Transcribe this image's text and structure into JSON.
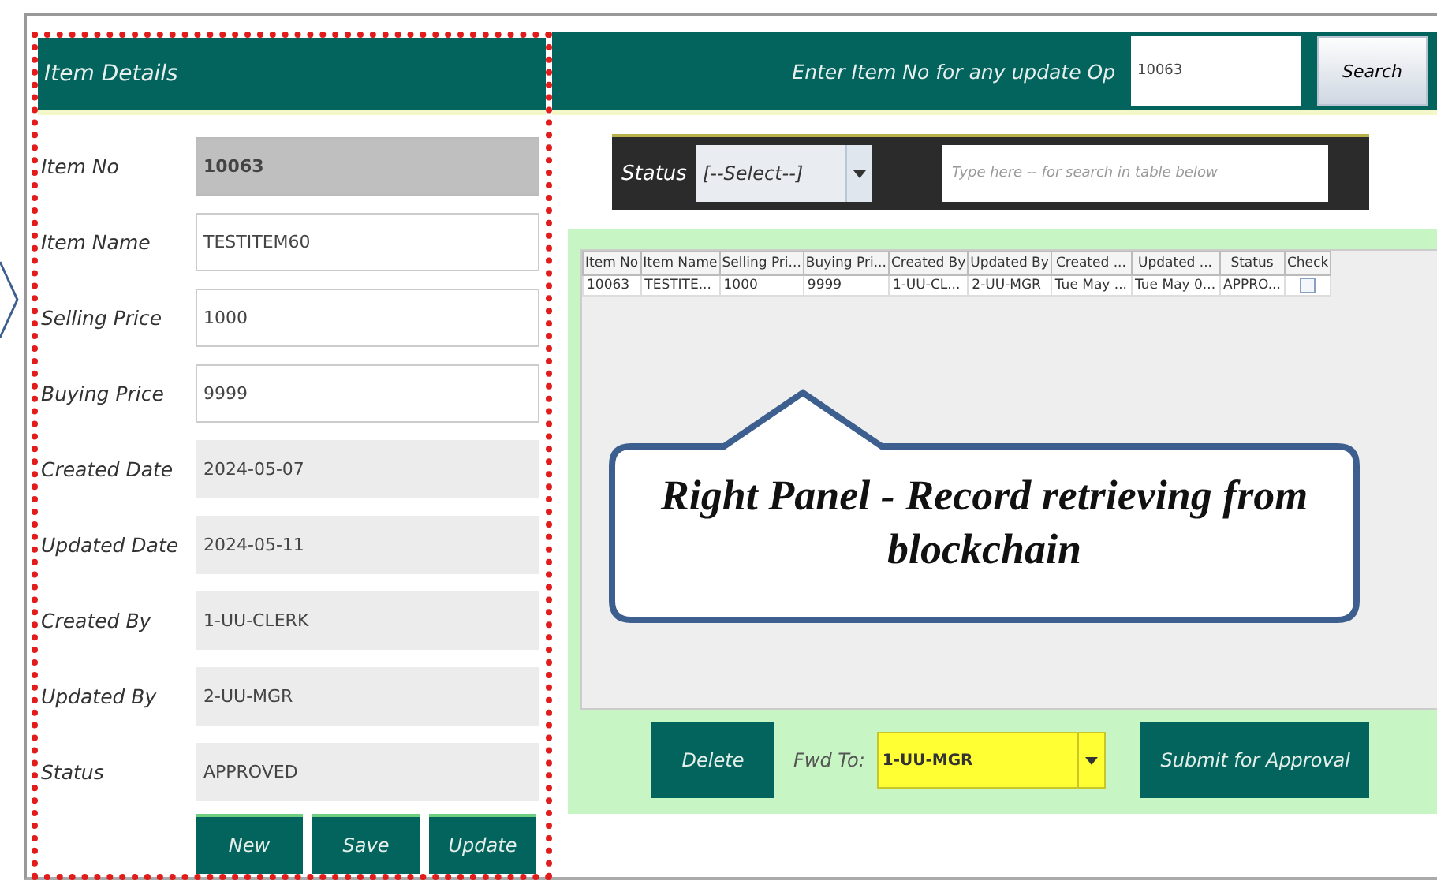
{
  "header": {
    "title": "Item Details",
    "search_label": "Enter Item No for any update Op",
    "search_value": "10063",
    "search_button": "Search"
  },
  "fields": [
    {
      "label": "Item No",
      "value": "10063",
      "kind": "locked"
    },
    {
      "label": "Item Name",
      "value": "TESTITEM60",
      "kind": "editable"
    },
    {
      "label": "Selling Price",
      "value": "1000",
      "kind": "editable"
    },
    {
      "label": "Buying Price",
      "value": "9999",
      "kind": "editable"
    },
    {
      "label": "Created Date",
      "value": "2024-05-07",
      "kind": "readonly"
    },
    {
      "label": "Updated Date",
      "value": "2024-05-11",
      "kind": "readonly"
    },
    {
      "label": "Created By",
      "value": "1-UU-CLERK",
      "kind": "readonly"
    },
    {
      "label": "Updated By",
      "value": "2-UU-MGR",
      "kind": "readonly"
    },
    {
      "label": "Status",
      "value": "APPROVED",
      "kind": "readonly"
    }
  ],
  "form_buttons": [
    "New",
    "Save",
    "Update"
  ],
  "filter": {
    "label": "Status",
    "select": "[--Select--]",
    "placeholder": "Type here -- for search in table below"
  },
  "table": {
    "columns": [
      "Item No",
      "Item Name",
      "Selling Pri...",
      "Buying Pri...",
      "Created By",
      "Updated By",
      "Created ...",
      "Updated ...",
      "Status",
      "Check"
    ],
    "rows": [
      {
        "cells": [
          "10063",
          "TESTITE...",
          "1000",
          "9999",
          "1-UU-CL...",
          "2-UU-MGR",
          "Tue May ...",
          "Tue May 0...",
          "APPRO..."
        ],
        "checked": false
      }
    ]
  },
  "callout": {
    "text": "Right Panel - Record retrieving from blockchain"
  },
  "actions": {
    "delete": "Delete",
    "fwd_label": "Fwd To:",
    "fwd_value": "1-UU-MGR",
    "submit": "Submit for Approval"
  }
}
